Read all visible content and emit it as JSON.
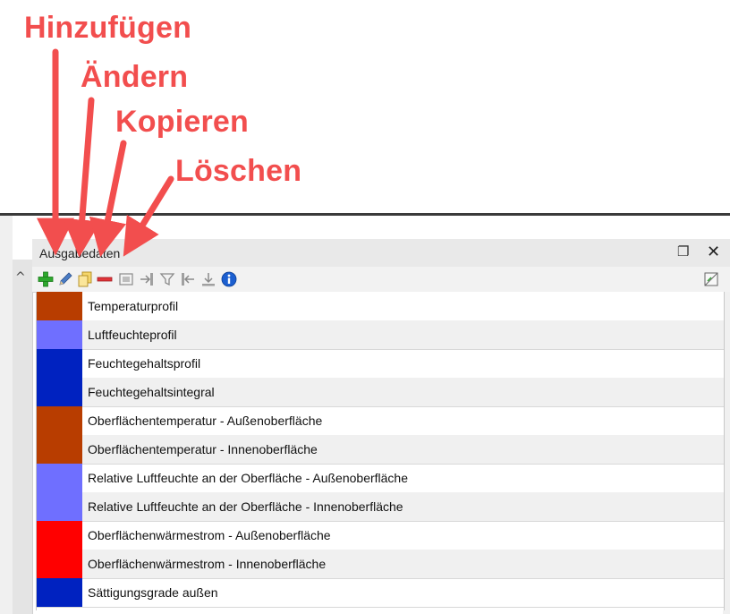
{
  "annotations": {
    "add": "Hinzufügen",
    "edit": "Ändern",
    "copy": "Kopieren",
    "delete": "Löschen",
    "color": "#f24e4e"
  },
  "panel": {
    "title": "Ausgabedaten",
    "float_icon": "float-window-icon",
    "close_label": "✕"
  },
  "toolbar": {
    "icons": [
      "add-icon",
      "edit-pencil-icon",
      "copy-icon",
      "delete-icon",
      "output-settings-icon",
      "move-right-icon",
      "filter-icon",
      "move-left-icon",
      "sort-icon",
      "info-icon",
      "table-toggle-icon"
    ]
  },
  "outputs": [
    {
      "label": "Temperaturprofil",
      "color": "#b83d00"
    },
    {
      "label": "Luftfeuchteprofil",
      "color": "#6f6fff"
    },
    {
      "label": "Feuchtegehaltsprofil",
      "color": "#0022c0"
    },
    {
      "label": "Feuchtegehaltsintegral",
      "color": "#0022c0"
    },
    {
      "label": "Oberflächentemperatur - Außenoberfläche",
      "color": "#b83d00"
    },
    {
      "label": "Oberflächentemperatur - Innenoberfläche",
      "color": "#b83d00"
    },
    {
      "label": "Relative Luftfeuchte an der Oberfläche - Außenoberfläche",
      "color": "#6f6fff"
    },
    {
      "label": "Relative Luftfeuchte an der Oberfläche - Innenoberfläche",
      "color": "#6f6fff"
    },
    {
      "label": "Oberflächenwärmestrom - Außenoberfläche",
      "color": "#ff0000"
    },
    {
      "label": "Oberflächenwärmestrom - Innenoberfläche",
      "color": "#ff0000"
    },
    {
      "label": "Sättigungsgrade außen",
      "color": "#0022c0"
    }
  ]
}
